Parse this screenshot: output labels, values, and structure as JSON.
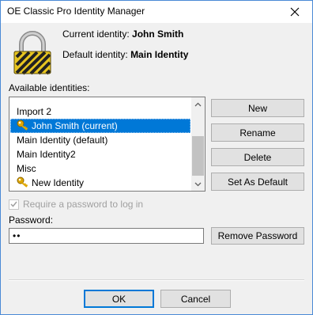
{
  "window": {
    "title": "OE Classic Pro Identity Manager"
  },
  "header": {
    "current_label": "Current identity:",
    "current_value": "John Smith",
    "default_label": "Default identity:",
    "default_value": "Main Identity"
  },
  "identities": {
    "label": "Available identities:",
    "items": [
      {
        "label": "Import 2"
      },
      {
        "label": "John Smith (current)"
      },
      {
        "label": "Main Identity (default)"
      },
      {
        "label": "Main Identity2"
      },
      {
        "label": "Misc"
      },
      {
        "label": "New Identity"
      }
    ]
  },
  "buttons": {
    "new": "New",
    "rename": "Rename",
    "delete": "Delete",
    "set_default": "Set As Default",
    "remove_password": "Remove Password",
    "ok": "OK",
    "cancel": "Cancel"
  },
  "password": {
    "require_label": "Require a password to log in",
    "require_checked": true,
    "label": "Password:",
    "value": "••"
  },
  "colors": {
    "selection": "#0078d7",
    "border_accent": "#4a8ad6"
  },
  "icons": {
    "lock": "padlock-icon",
    "key": "key-icon",
    "close": "close-icon"
  }
}
